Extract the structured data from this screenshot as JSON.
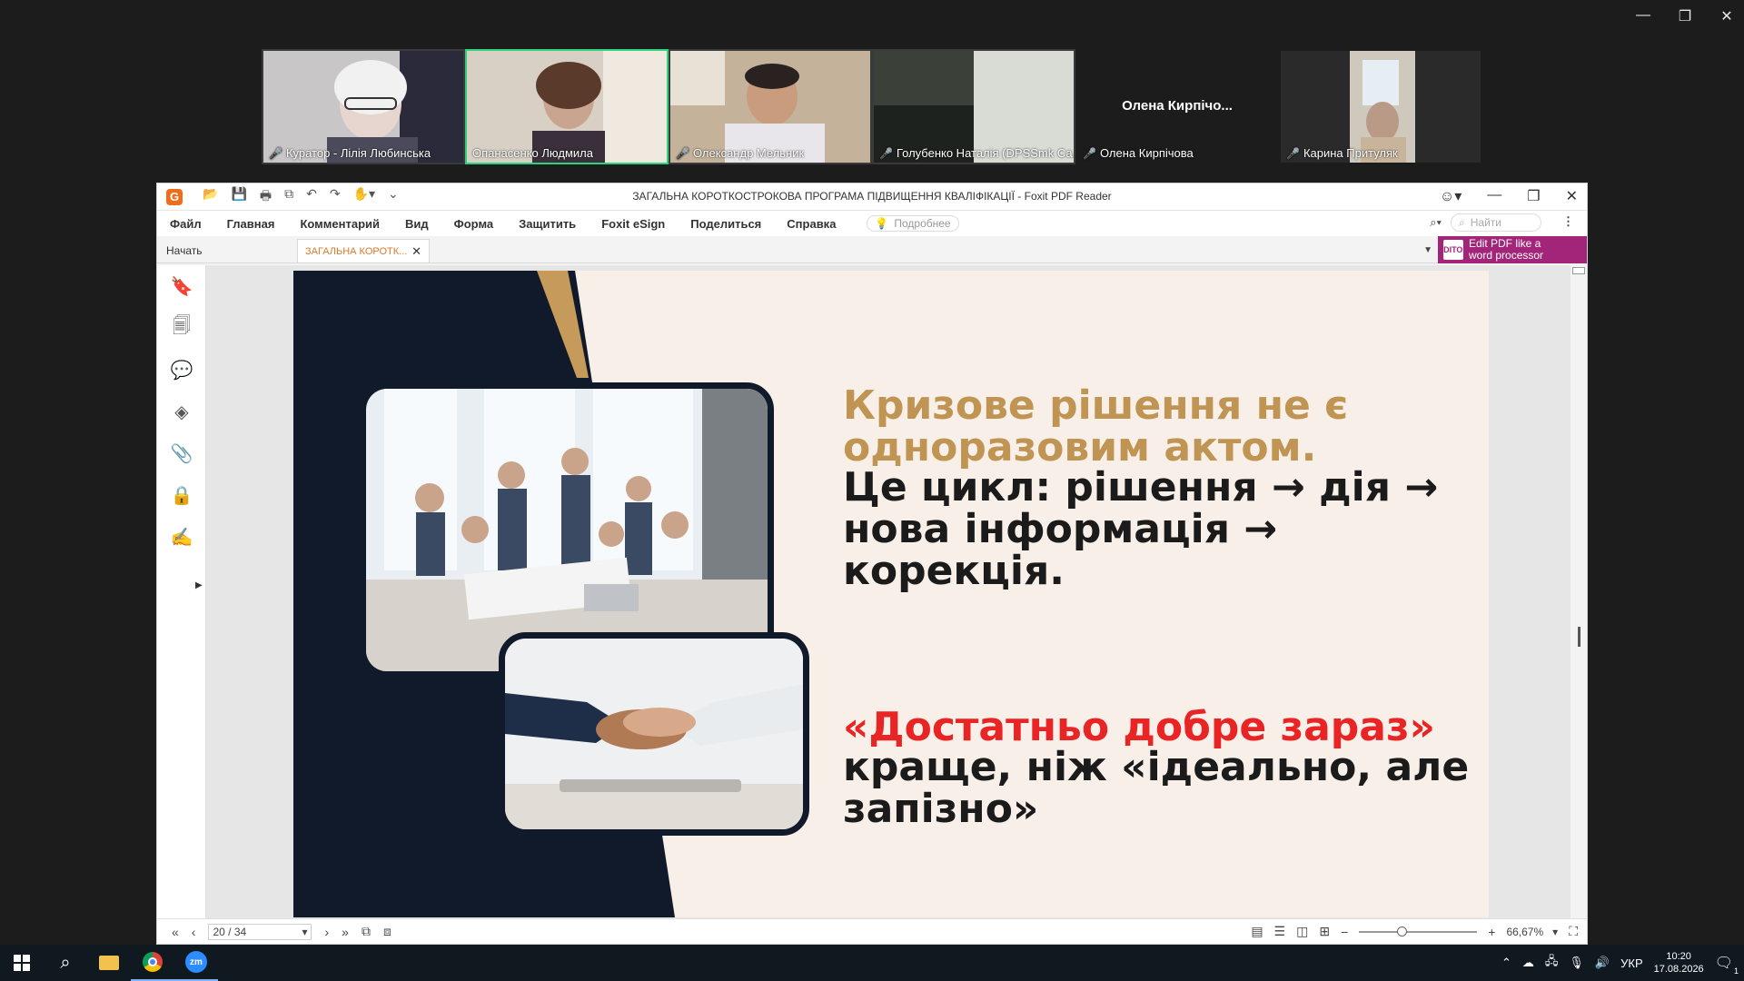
{
  "zoom": {
    "participants": [
      {
        "name": "Куратор - Лілія Любинська",
        "muted": true,
        "active": false
      },
      {
        "name": "Опанасенко Людмила",
        "muted": false,
        "active": true
      },
      {
        "name": "Олександр Мельник",
        "muted": true,
        "active": false
      },
      {
        "name": "Голубенко Наталія (DPSSmk Са...",
        "muted": true,
        "active": false
      },
      {
        "name": "Олена  Кирпічова",
        "muted": true,
        "active": false,
        "no_video_name": "Олена  Кирпічо..."
      },
      {
        "name": "Карина Притуляк",
        "muted": true,
        "active": false
      }
    ]
  },
  "foxit": {
    "title": "ЗАГАЛЬНА КОРОТКОСТРОКОВА ПРОГРАМА ПІДВИЩЕННЯ КВАЛІФІКАЦІЇ - Foxit PDF Reader",
    "menu": [
      "Файл",
      "Главная",
      "Комментарий",
      "Вид",
      "Форма",
      "Защитить",
      "Foxit eSign",
      "Поделиться",
      "Справка"
    ],
    "tell_me": "Подробнее",
    "search_placeholder": "Найти",
    "tabs": {
      "start": "Начать",
      "doc": "ЗАГАЛЬНА КОРОТК..."
    },
    "promo": {
      "line1": "Edit PDF like a",
      "line2": "word processor",
      "badge": "EDITOR"
    },
    "page": "20 / 34",
    "zoom_level": "66,67%"
  },
  "slide": {
    "gold_line1": "Кризове рішення не є",
    "gold_line2": "одноразовим актом.",
    "dark_line1": "Це цикл: рішення → дія →",
    "dark_line2": "нова інформація →",
    "dark_line3": "корекція.",
    "red_line": "«Достатньо добре зараз»",
    "dark2_line1": "краще, ніж «ідеально, але",
    "dark2_line2": "запізно»",
    "colors": {
      "gold": "#c09452",
      "red": "#e82424",
      "navy": "#111a2b",
      "bg": "#f7efe8"
    }
  },
  "taskbar": {
    "language": "УКР",
    "time": "10:20",
    "date": "17.08.2026",
    "notifications": "1"
  }
}
